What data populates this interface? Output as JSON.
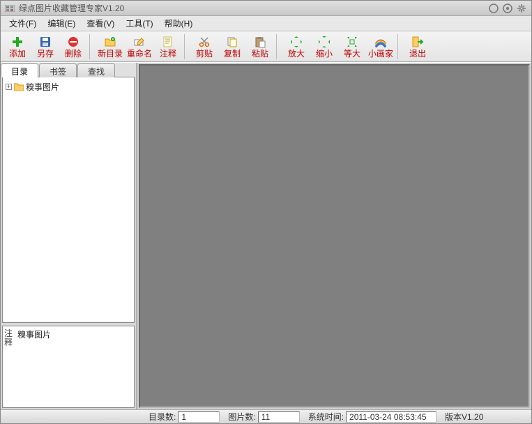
{
  "title": "绿点图片收藏管理专家V1.20",
  "menu": {
    "file": "文件(F)",
    "edit": "编辑(E)",
    "view": "查看(V)",
    "tools": "工具(T)",
    "help": "帮助(H)"
  },
  "toolbar": {
    "add": "添加",
    "saveas": "另存",
    "delete": "删除",
    "newdir": "新目录",
    "rename": "重命名",
    "note": "注释",
    "cut": "剪贴",
    "copy": "复制",
    "paste": "粘贴",
    "zoomin": "放大",
    "zoomout": "缩小",
    "equal": "等大",
    "painter": "小画家",
    "exit": "退出"
  },
  "tabs": {
    "dir": "目录",
    "bookmark": "书签",
    "search": "查找"
  },
  "tree": {
    "root": "糗事图片"
  },
  "note": {
    "label1": "注",
    "label2": "释",
    "content": "糗事图片"
  },
  "status": {
    "dirs_label": "目录数:",
    "dirs_value": "1",
    "imgs_label": "图片数:",
    "imgs_value": "11",
    "time_label": "系统时间:",
    "time_value": "2011-03-24 08:53:45",
    "version": "版本V1.20"
  }
}
